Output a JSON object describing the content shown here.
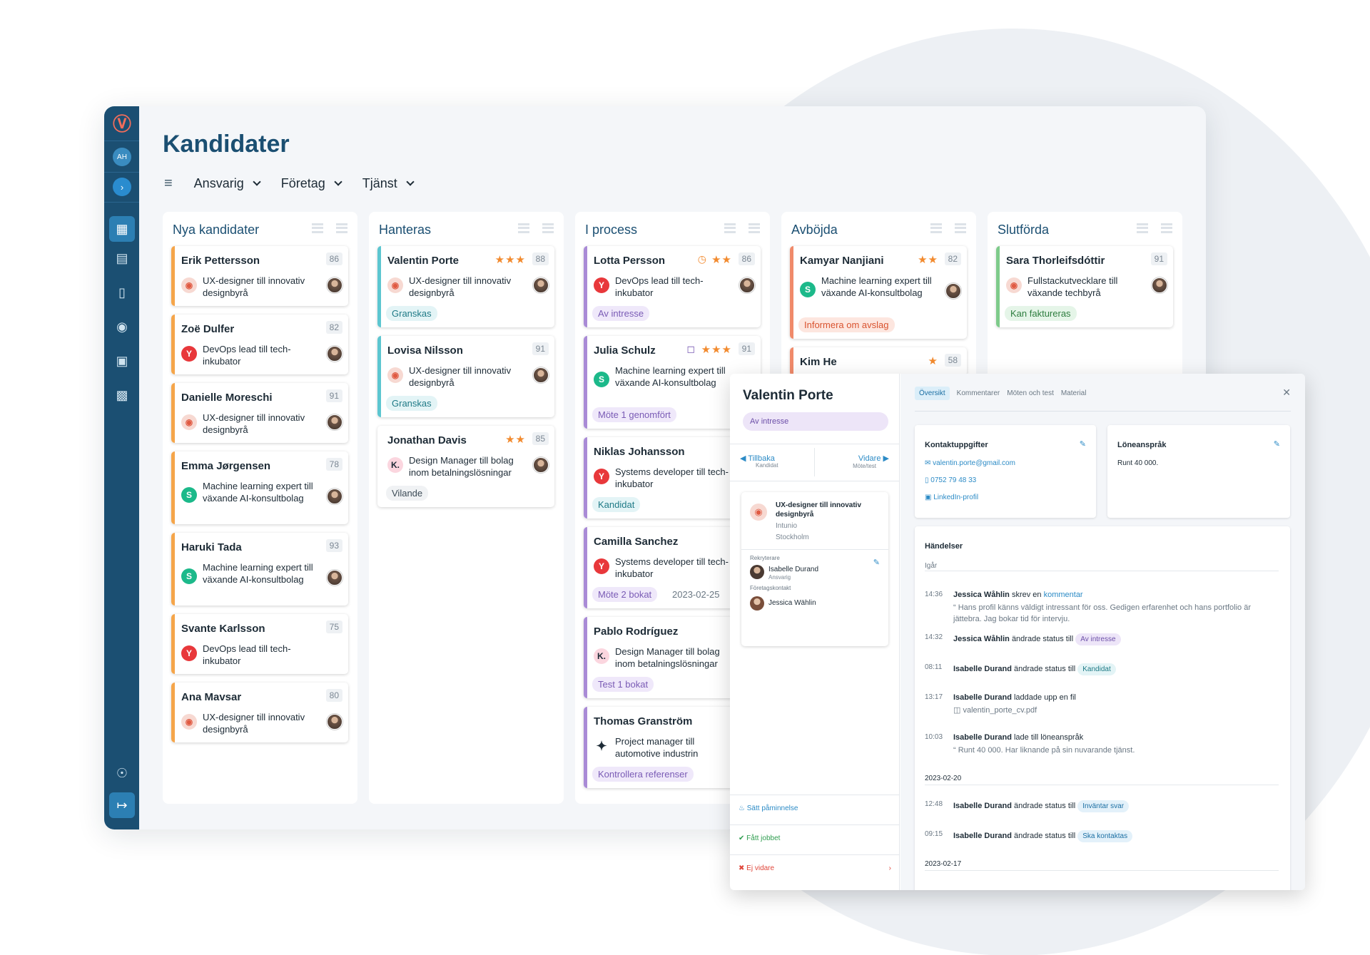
{
  "page": {
    "title": "Kandidater"
  },
  "sidebar": {
    "avatar": "AH"
  },
  "filters": [
    "Ansvarig",
    "Företag",
    "Tjänst"
  ],
  "columns": [
    {
      "title": "Nya kandidater",
      "cards": [
        {
          "name": "Erik Pettersson",
          "score": "86",
          "job": "UX-designer till innovativ designbyrå"
        },
        {
          "name": "Zoë Dulfer",
          "score": "82",
          "job": "DevOps lead till tech-inkubator"
        },
        {
          "name": "Danielle Moreschi",
          "score": "91",
          "job": "UX-designer till innovativ designbyrå"
        },
        {
          "name": "Emma Jørgensen",
          "score": "78",
          "job": "Machine learning expert till växande AI-konsultbolag"
        },
        {
          "name": "Haruki Tada",
          "score": "93",
          "job": "Machine learning expert till växande AI-konsultbolag"
        },
        {
          "name": "Svante Karlsson",
          "score": "75",
          "job": "DevOps lead till tech-inkubator"
        },
        {
          "name": "Ana Mavsar",
          "score": "80",
          "job": "UX-designer till innovativ designbyrå"
        }
      ]
    },
    {
      "title": "Hanteras",
      "cards": [
        {
          "name": "Valentin Porte",
          "score": "88",
          "job": "UX-designer till innovativ designbyrå",
          "tag": "Granskas"
        },
        {
          "name": "Lovisa Nilsson",
          "score": "91",
          "job": "UX-designer till innovativ designbyrå",
          "tag": "Granskas"
        },
        {
          "name": "Jonathan Davis",
          "score": "85",
          "job": "Design Manager till bolag inom betalningslösningar",
          "tag": "Vilande"
        }
      ]
    },
    {
      "title": "I process",
      "cards": [
        {
          "name": "Lotta Persson",
          "score": "86",
          "job": "DevOps lead till tech-inkubator",
          "tag": "Av intresse"
        },
        {
          "name": "Julia Schulz",
          "score": "91",
          "job": "Machine learning expert till växande AI-konsultbolag",
          "tag": "Möte 1 genomfört"
        },
        {
          "name": "Niklas Johansson",
          "job": "Systems developer till tech-inkubator",
          "tag": "Kandidat"
        },
        {
          "name": "Camilla Sanchez",
          "job": "Systems developer till tech-inkubator",
          "tag": "Möte 2 bokat",
          "date": "2023-02-25"
        },
        {
          "name": "Pablo Rodríguez",
          "job": "Design Manager till bolag inom betalningslösningar",
          "tag": "Test 1 bokat"
        },
        {
          "name": "Thomas Granström",
          "job": "Project manager till automotive industrin",
          "tag": "Kontrollera referenser"
        }
      ]
    },
    {
      "title": "Avböjda",
      "cards": [
        {
          "name": "Kamyar Nanjiani",
          "score": "82",
          "job": "Machine learning expert till växande AI-konsultbolag",
          "tag": "Informera om avslag"
        },
        {
          "name": "Kim He",
          "score": "58"
        }
      ]
    },
    {
      "title": "Slutförda",
      "cards": [
        {
          "name": "Sara Thorleifsdóttir",
          "score": "91",
          "job": "Fullstackutvecklare till växande techbyrå",
          "tag": "Kan faktureras"
        }
      ]
    }
  ],
  "detail": {
    "name": "Valentin Porte",
    "status": "Av intresse",
    "back": "Tillbaka",
    "back_sub": "Kandidat",
    "next": "Vidare",
    "next_sub": "Möte/test",
    "job_title": "UX-designer till innovativ designbyrå",
    "company": "Intunio",
    "city": "Stockholm",
    "recruiter_label": "Rekryterare",
    "recruiter": "Isabelle Durand",
    "recruiter_role": "Ansvarig",
    "contact_label": "Företagskontakt",
    "contact": "Jessica Wählin",
    "reminder": "Sätt påminnelse",
    "got_job": "Fått jobbet",
    "not_further": "Ej vidare",
    "tabs": [
      "Översikt",
      "Kommentarer",
      "Möten och test",
      "Material"
    ],
    "contact_title": "Kontaktuppgifter",
    "email": "valentin.porte@gmail.com",
    "phone": "0752 79 48 33",
    "linkedin": "LinkedIn-profil",
    "salary_title": "Löneanspråk",
    "salary": "Runt 40 000.",
    "events_title": "Händelser",
    "day1": "Igår",
    "day2": "2023-02-20",
    "day3": "2023-02-17",
    "events": [
      {
        "time": "14:36",
        "who": "Jessica Wåhlin",
        "text": "skrev en",
        "link": "kommentar",
        "quote": "Hans profil känns väldigt intressant för oss. Gedigen erfarenhet och hans portfolio är jättebra. Jag bokar tid för intervju."
      },
      {
        "time": "14:32",
        "who": "Jessica Wåhlin",
        "text": "ändrade status till",
        "pill": "Av intresse"
      },
      {
        "time": "08:11",
        "who": "Isabelle Durand",
        "text": "ändrade status till",
        "pill": "Kandidat"
      },
      {
        "time": "13:17",
        "who": "Isabelle Durand",
        "text": "laddade upp en fil",
        "file": "valentin_porte_cv.pdf"
      },
      {
        "time": "10:03",
        "who": "Isabelle Durand",
        "text": "lade till löneanspråk",
        "quote": "Runt 40 000. Har liknande på sin nuvarande tjänst."
      },
      {
        "time": "12:48",
        "who": "Isabelle Durand",
        "text": "ändrade status till",
        "pill": "Inväntar svar"
      },
      {
        "time": "09:15",
        "who": "Isabelle Durand",
        "text": "ändrade status till",
        "pill": "Ska kontaktas"
      }
    ]
  }
}
